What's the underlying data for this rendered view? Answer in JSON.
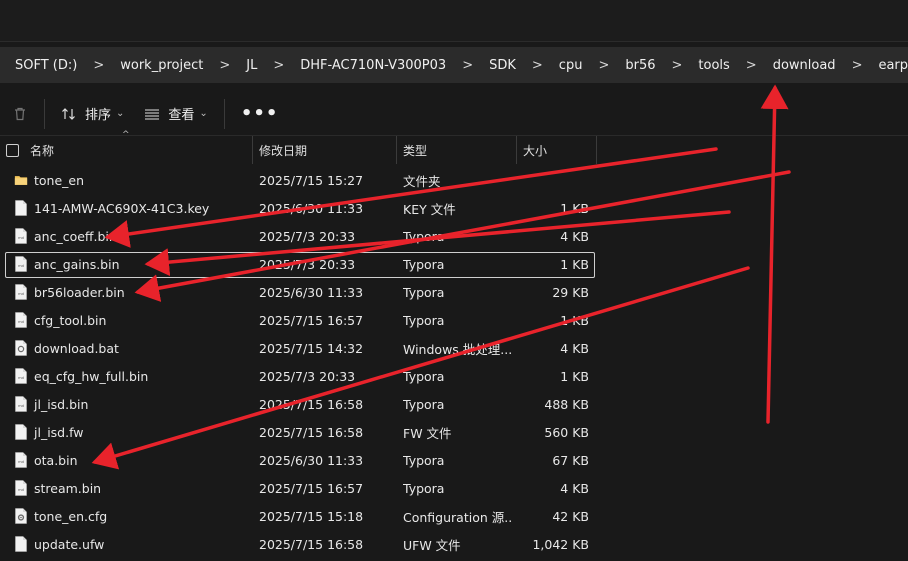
{
  "breadcrumb": [
    "SOFT (D:)",
    "work_project",
    "JL",
    "DHF-AC710N-V300P03",
    "SDK",
    "cpu",
    "br56",
    "tools",
    "download",
    "earphone"
  ],
  "breadcrumb_separator": ">",
  "toolbar": {
    "sort_label": "排序",
    "view_label": "查看",
    "more_label": "•••"
  },
  "columns": {
    "name": "名称",
    "date": "修改日期",
    "type": "类型",
    "size": "大小"
  },
  "files": [
    {
      "name": "tone_en",
      "date": "2025/7/15 15:27",
      "type": "文件夹",
      "size": "",
      "icon": "folder-icon"
    },
    {
      "name": "141-AMW-AC690X-41C3.key",
      "date": "2025/6/30 11:33",
      "type": "KEY 文件",
      "size": "1 KB",
      "icon": "file-icon"
    },
    {
      "name": "anc_coeff.bin",
      "date": "2025/7/3 20:33",
      "type": "Typora",
      "size": "4 KB",
      "icon": "typora-file-icon"
    },
    {
      "name": "anc_gains.bin",
      "date": "2025/7/3 20:33",
      "type": "Typora",
      "size": "1 KB",
      "icon": "typora-file-icon"
    },
    {
      "name": "br56loader.bin",
      "date": "2025/6/30 11:33",
      "type": "Typora",
      "size": "29 KB",
      "icon": "typora-file-icon"
    },
    {
      "name": "cfg_tool.bin",
      "date": "2025/7/15 16:57",
      "type": "Typora",
      "size": "1 KB",
      "icon": "typora-file-icon"
    },
    {
      "name": "download.bat",
      "date": "2025/7/15 14:32",
      "type": "Windows 批处理...",
      "size": "4 KB",
      "icon": "batch-file-icon"
    },
    {
      "name": "eq_cfg_hw_full.bin",
      "date": "2025/7/3 20:33",
      "type": "Typora",
      "size": "1 KB",
      "icon": "typora-file-icon"
    },
    {
      "name": "jl_isd.bin",
      "date": "2025/7/15 16:58",
      "type": "Typora",
      "size": "488 KB",
      "icon": "typora-file-icon"
    },
    {
      "name": "jl_isd.fw",
      "date": "2025/7/15 16:58",
      "type": "FW 文件",
      "size": "560 KB",
      "icon": "file-icon"
    },
    {
      "name": "ota.bin",
      "date": "2025/6/30 11:33",
      "type": "Typora",
      "size": "67 KB",
      "icon": "typora-file-icon"
    },
    {
      "name": "stream.bin",
      "date": "2025/7/15 16:57",
      "type": "Typora",
      "size": "4 KB",
      "icon": "typora-file-icon"
    },
    {
      "name": "tone_en.cfg",
      "date": "2025/7/15 15:18",
      "type": "Configuration 源...",
      "size": "42 KB",
      "icon": "config-file-icon"
    },
    {
      "name": "update.ufw",
      "date": "2025/7/15 16:58",
      "type": "UFW 文件",
      "size": "1,042 KB",
      "icon": "file-icon"
    }
  ],
  "focused_file": "anc_gains.bin",
  "colors": {
    "annotation_arrow": "#e8232b",
    "background": "#191919",
    "address_bar": "#2b2b2b"
  }
}
